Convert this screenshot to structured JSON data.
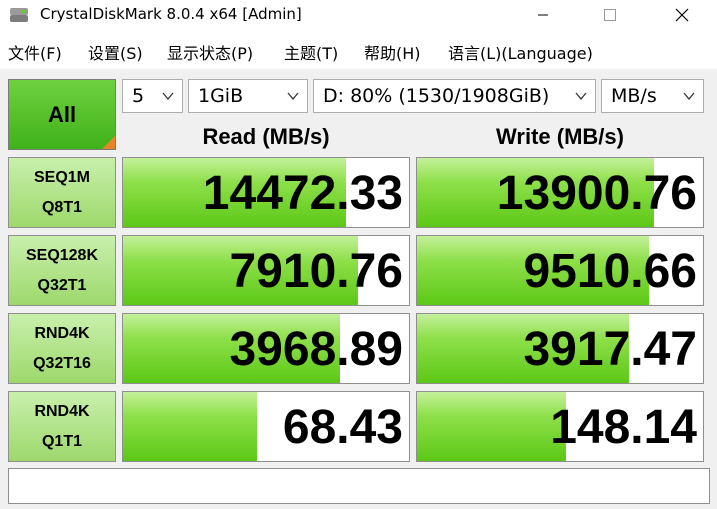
{
  "window": {
    "title": "CrystalDiskMark 8.0.4 x64 [Admin]"
  },
  "menu": [
    "文件(F)",
    "设置(S)",
    "显示状态(P)",
    "主题(T)",
    "帮助(H)",
    "语言(L)(Language)"
  ],
  "controls": {
    "all_label": "All",
    "count": "5",
    "size": "1GiB",
    "drive": "D: 80% (1530/1908GiB)",
    "unit": "MB/s"
  },
  "headers": {
    "read": "Read (MB/s)",
    "write": "Write (MB/s)"
  },
  "tests": [
    {
      "line1": "SEQ1M",
      "line2": "Q8T1",
      "read": "14472.33",
      "write": "13900.76",
      "read_fill": 0.78,
      "write_fill": 0.83
    },
    {
      "line1": "SEQ128K",
      "line2": "Q32T1",
      "read": "7910.76",
      "write": "9510.66",
      "read_fill": 0.82,
      "write_fill": 0.81
    },
    {
      "line1": "RND4K",
      "line2": "Q32T16",
      "read": "3968.89",
      "write": "3917.47",
      "read_fill": 0.76,
      "write_fill": 0.74
    },
    {
      "line1": "RND4K",
      "line2": "Q1T1",
      "read": "68.43",
      "write": "148.14",
      "read_fill": 0.47,
      "write_fill": 0.52
    }
  ],
  "comment": "",
  "colors": {
    "bar": "#5cc816",
    "all_button": "#3fb21a",
    "corner": "#e8842a"
  }
}
